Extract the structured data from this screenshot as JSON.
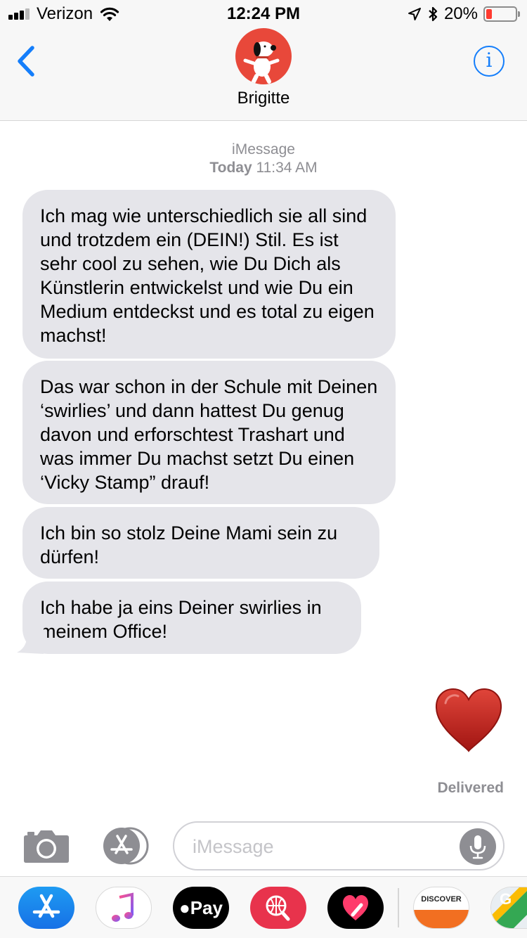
{
  "status_bar": {
    "carrier": "Verizon",
    "time": "12:24 PM",
    "battery_percent": "20%",
    "battery_level": 0.2,
    "signal_bars_active": 3,
    "signal_bars_total": 4,
    "icons": [
      "signal-icon",
      "wifi-icon",
      "location-arrow-icon",
      "bluetooth-icon",
      "battery-icon"
    ]
  },
  "header": {
    "contact_name": "Brigitte",
    "avatar_color": "#e8483a",
    "back_icon": "chevron-left-icon",
    "info_icon": "info-icon",
    "info_glyph": "i",
    "accent_color": "#147efb"
  },
  "thread": {
    "service": "iMessage",
    "date_bold": "Today",
    "time": "11:34 AM",
    "messages": [
      {
        "direction": "incoming",
        "text": "Ich mag wie unterschiedlich sie all sind und trotzdem ein (DEIN!) Stil. Es ist sehr cool zu sehen, wie Du Dich als Künstlerin entwickelst und wie Du ein Medium entdeckst und es total zu eigen machst!"
      },
      {
        "direction": "incoming",
        "text": "Das war schon in der Schule mit Deinen ‘swirlies’ und dann hattest Du genug davon und erforschtest Trashart und was immer Du machst setzt Du einen ‘Vicky Stamp” drauf!"
      },
      {
        "direction": "incoming",
        "text": "Ich bin so stolz Deine Mami sein zu dürfen!"
      },
      {
        "direction": "incoming",
        "text": "Ich habe ja eins Deiner swirlies in meinem Office!"
      },
      {
        "direction": "outgoing",
        "emoji": "red-heart"
      }
    ],
    "delivered_label": "Delivered",
    "incoming_bubble_color": "#e5e5ea"
  },
  "composer": {
    "placeholder": "iMessage",
    "camera_icon": "camera-icon",
    "apps_icon": "app-store-icon",
    "mic_icon": "microphone-icon"
  },
  "app_drawer": {
    "apps": [
      {
        "name": "App Store",
        "icon": "app-store-icon"
      },
      {
        "name": "Music",
        "icon": "music-note-icon"
      },
      {
        "name": "Apple Pay",
        "icon": "apple-pay-icon",
        "label": "Pay"
      },
      {
        "name": "Web search",
        "icon": "globe-search-icon"
      },
      {
        "name": "Heart stickers",
        "icon": "heart-sticker-icon"
      },
      {
        "name": "Discover",
        "icon": "discover-icon",
        "label": "DISCOVER"
      },
      {
        "name": "Google Maps",
        "icon": "google-maps-icon",
        "label": "G"
      }
    ]
  }
}
